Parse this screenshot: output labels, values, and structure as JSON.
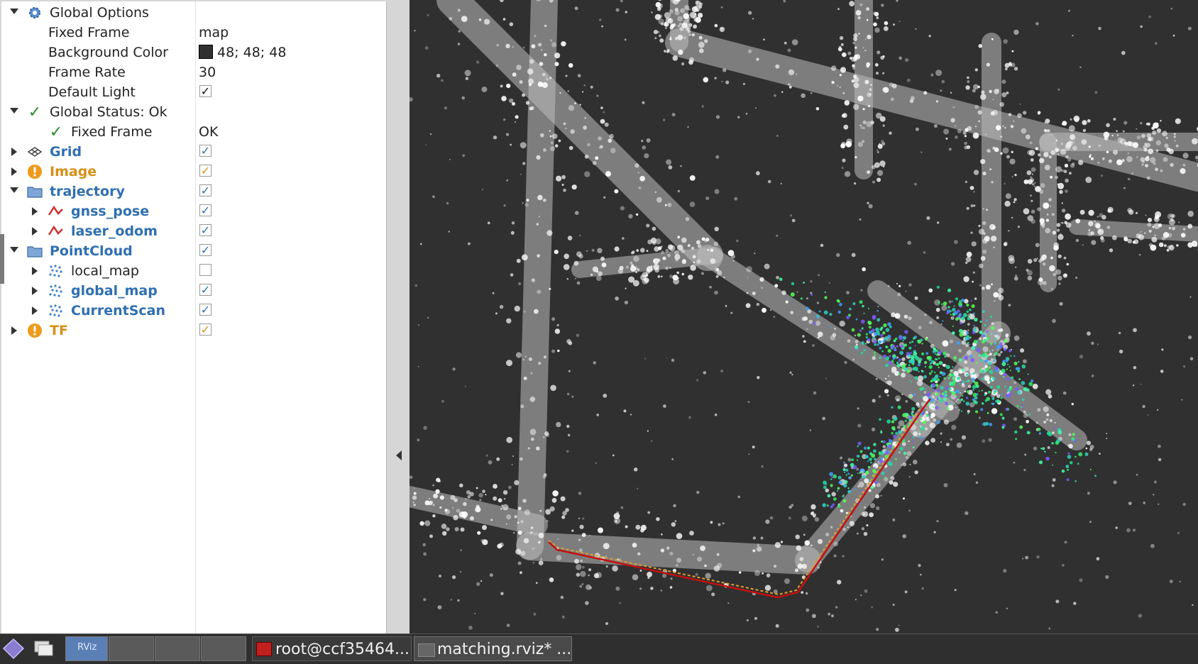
{
  "tree": {
    "global_options": "Global Options",
    "fixed_frame": {
      "label": "Fixed Frame",
      "value": "map"
    },
    "background_color": {
      "label": "Background Color",
      "value": "48; 48; 48",
      "swatch": "#303030"
    },
    "frame_rate": {
      "label": "Frame Rate",
      "value": "30"
    },
    "default_light": {
      "label": "Default Light",
      "checked": true
    },
    "global_status": "Global Status: Ok",
    "status_fixed_frame": {
      "label": "Fixed Frame",
      "value": "OK"
    },
    "grid": {
      "label": "Grid",
      "checked": true
    },
    "image": {
      "label": "Image",
      "checked": true
    },
    "trajectory": {
      "label": "trajectory",
      "checked": true
    },
    "gnss_pose": {
      "label": "gnss_pose",
      "checked": true
    },
    "laser_odom": {
      "label": "laser_odom",
      "checked": true
    },
    "pointcloud": {
      "label": "PointCloud",
      "checked": true
    },
    "local_map": {
      "label": "local_map",
      "checked": false
    },
    "global_map": {
      "label": "global_map",
      "checked": true
    },
    "current_scan": {
      "label": "CurrentScan",
      "checked": true
    },
    "tf": {
      "label": "TF",
      "checked": true
    },
    "check_glyph": "✓"
  },
  "taskbar": {
    "rviz_icon_label": "RViz",
    "terminal_label": "root@ccf35464...",
    "window_label": "matching.rviz* ..."
  },
  "colors": {
    "plugin_blue": "#2f6fb1",
    "warn_orange": "#d59018",
    "status_green": "#2a8a2a",
    "background": "#303030"
  }
}
